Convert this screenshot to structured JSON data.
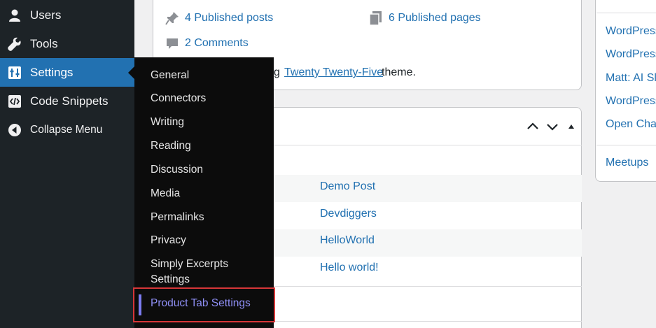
{
  "sidebar": {
    "items": [
      {
        "label": "Users",
        "icon": "user-icon"
      },
      {
        "label": "Tools",
        "icon": "wrench-icon"
      },
      {
        "label": "Settings",
        "icon": "settings-sliders-icon"
      },
      {
        "label": "Code Snippets",
        "icon": "code-snippets-icon"
      },
      {
        "label": "Collapse Menu",
        "icon": "collapse-arrow-icon"
      }
    ]
  },
  "settings_submenu": {
    "items": [
      "General",
      "Connectors",
      "Writing",
      "Reading",
      "Discussion",
      "Media",
      "Permalinks",
      "Privacy",
      "Simply Excerpts Settings"
    ],
    "highlighted": "Product Tab Settings"
  },
  "at_a_glance": {
    "posts": "4 Published posts",
    "pages": "6 Published pages",
    "comments": "2 Comments",
    "theme_prefix": "g",
    "theme_name": "Twenty Twenty-Five",
    "theme_suffix": "theme."
  },
  "activity": {
    "posts": [
      "Demo Post",
      "Devdiggers",
      "HelloWorld",
      "Hello world!"
    ]
  },
  "news": {
    "links": [
      "WordPress",
      "WordPress",
      "Matt: AI Sl",
      "WordPress",
      "Open Char"
    ],
    "meetups": "Meetups"
  },
  "colors": {
    "sidebar_bg": "#1d2327",
    "active_bg": "#2271b1",
    "link": "#2271b1",
    "highlight_border": "#d63638"
  }
}
